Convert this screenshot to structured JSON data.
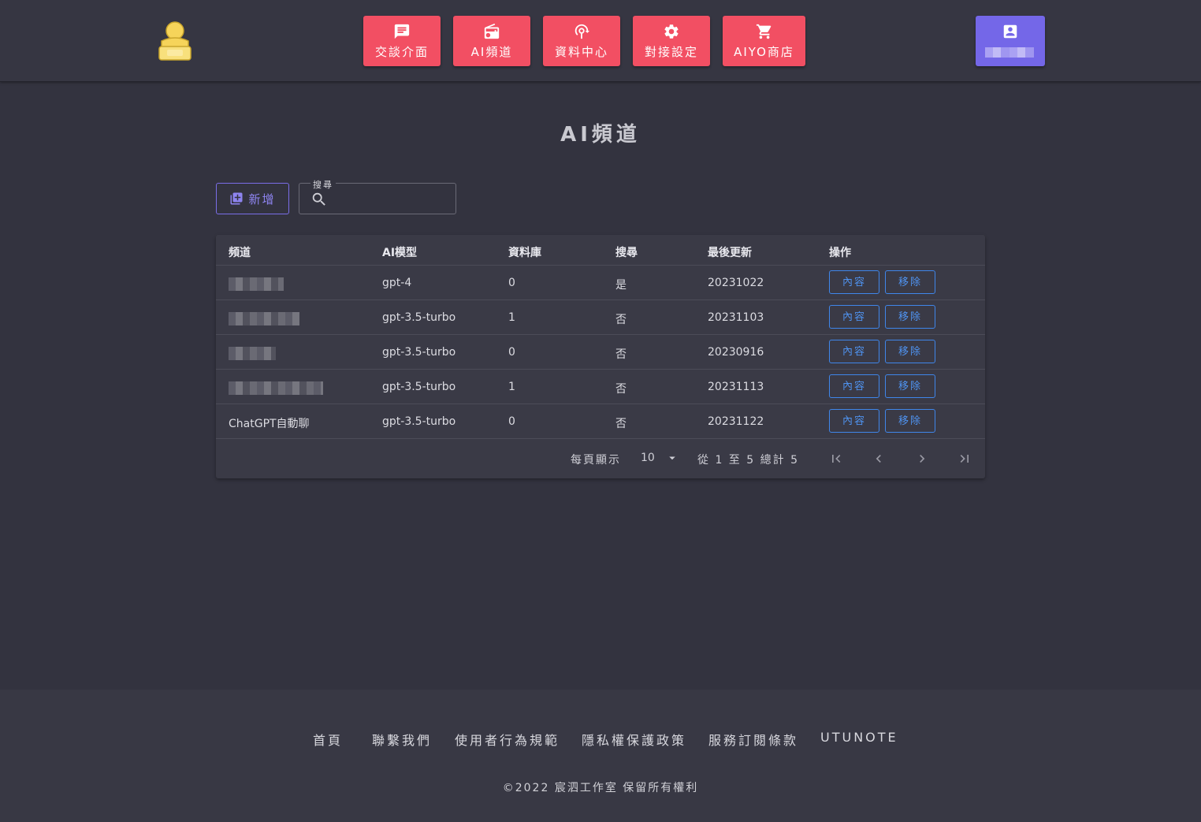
{
  "header": {
    "nav": [
      {
        "label": "交談介面",
        "icon": "chat-icon"
      },
      {
        "label": "AI頻道",
        "icon": "radio-icon"
      },
      {
        "label": "資料中心",
        "icon": "data-center-icon"
      },
      {
        "label": "對接設定",
        "icon": "gear-icon"
      },
      {
        "label": "AIYO商店",
        "icon": "cart-icon"
      }
    ],
    "nav_color": "#f24f63",
    "user_color": "#7467e8"
  },
  "page": {
    "title": "AI頻道"
  },
  "toolbar": {
    "add_label": "新增",
    "search_label": "搜尋",
    "search_value": ""
  },
  "table": {
    "headers": [
      "頻道",
      "AI模型",
      "資料庫",
      "搜尋",
      "最後更新",
      "操作"
    ],
    "rows": [
      {
        "channel": "",
        "model": "gpt-4",
        "db": "0",
        "search": "是",
        "updated": "20231022"
      },
      {
        "channel": "",
        "model": "gpt-3.5-turbo",
        "db": "1",
        "search": "否",
        "updated": "20231103"
      },
      {
        "channel": "",
        "model": "gpt-3.5-turbo",
        "db": "0",
        "search": "否",
        "updated": "20230916"
      },
      {
        "channel": "",
        "model": "gpt-3.5-turbo",
        "db": "1",
        "search": "否",
        "updated": "20231113"
      },
      {
        "channel": "ChatGPT自動聊",
        "model": "gpt-3.5-turbo",
        "db": "0",
        "search": "否",
        "updated": "20231122"
      }
    ],
    "content_label": "內容",
    "remove_label": "移除"
  },
  "pagination": {
    "per_page_label": "每頁顯示",
    "per_page_value": "10",
    "range_text": "從 1 至 5 總計 5"
  },
  "footer": {
    "links": [
      "首頁",
      "聯繫我們",
      "使用者行為規範",
      "隱私權保護政策",
      "服務訂閱條款",
      "UTUNOTE"
    ],
    "copyright": "©2022 宸泗工作室 保留所有權利"
  }
}
